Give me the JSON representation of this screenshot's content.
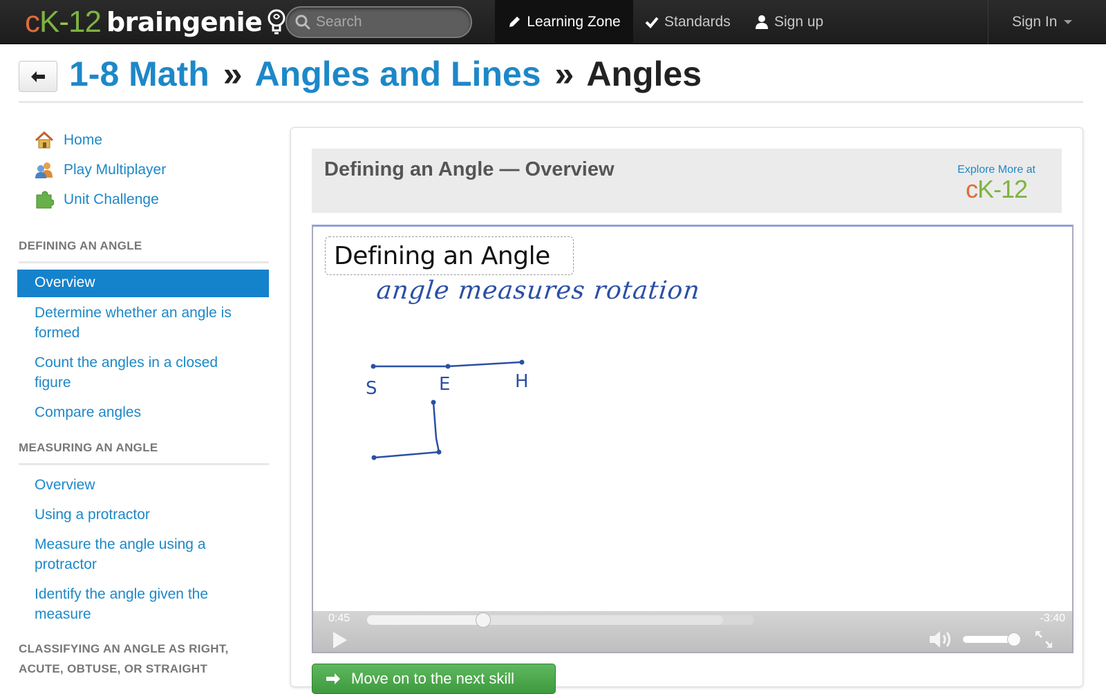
{
  "nav": {
    "logo_ck_c": "c",
    "logo_ck_k": "K",
    "logo_ck_dash": "-",
    "logo_ck_num": "12",
    "logo_brand": "braingenie",
    "search_placeholder": "Search",
    "learning_zone": "Learning Zone",
    "standards": "Standards",
    "sign_up": "Sign up",
    "sign_in": "Sign In"
  },
  "breadcrumb": {
    "level1": "1-8 Math",
    "sep": "»",
    "level2": "Angles and Lines",
    "current": "Angles"
  },
  "sidebar": {
    "links": [
      {
        "label": "Home",
        "icon": "home-icon"
      },
      {
        "label": "Play Multiplayer",
        "icon": "multiplayer-icon"
      },
      {
        "label": "Unit Challenge",
        "icon": "puzzle-icon"
      }
    ],
    "sections": [
      {
        "heading": "DEFINING AN ANGLE",
        "items": [
          "Overview",
          "Determine whether an angle is formed",
          "Count the angles in a closed figure",
          "Compare angles"
        ],
        "active_index": 0
      },
      {
        "heading": "MEASURING AN ANGLE",
        "items": [
          "Overview",
          "Using a protractor",
          "Measure the angle using a protractor",
          "Identify the angle given the measure"
        ]
      },
      {
        "heading": "CLASSIFYING AN ANGLE AS RIGHT, ACUTE, OBTUSE, OR STRAIGHT",
        "items": []
      }
    ]
  },
  "main": {
    "video_title": "Defining an Angle — Overview",
    "explore_text": "Explore More at",
    "explore_logo": "cK-12",
    "whiteboard": {
      "title": "Defining an Angle",
      "subtitle": "angle measures rotation",
      "label_s": "S",
      "label_e": "E",
      "label_h": "H"
    },
    "player": {
      "current_time": "0:45",
      "remaining_time": "-3:40",
      "progress": 0.3,
      "buffered": 0.92,
      "volume": 0.95
    },
    "next_button": "Move on to the next skill"
  },
  "colors": {
    "link": "#1d88c8",
    "active": "#1582cc",
    "topbar": "#222222",
    "ink": "#2a4fa5",
    "next_button": "#4aa84a"
  }
}
